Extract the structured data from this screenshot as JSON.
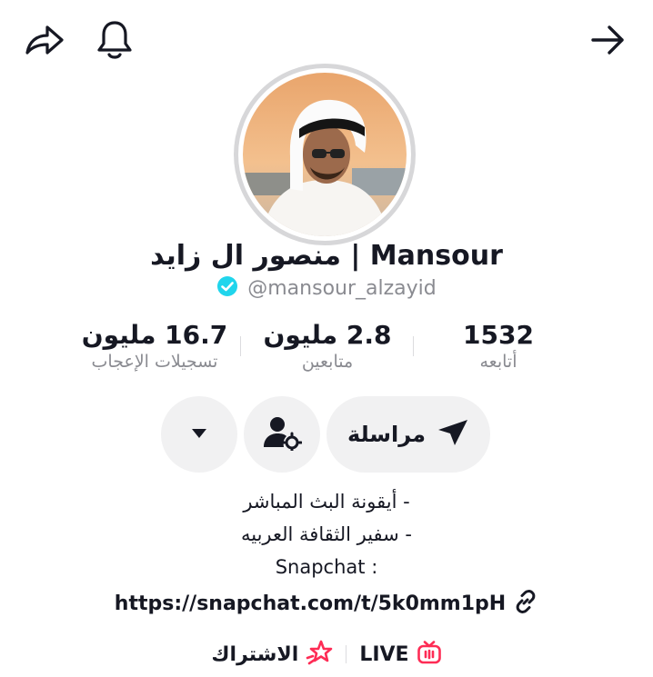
{
  "topbar": {
    "share_icon": "share-arrow-icon",
    "bell_icon": "bell-icon",
    "back_icon": "arrow-right-icon"
  },
  "profile": {
    "display_name": "منصور ال زايد | Mansour",
    "handle": "@mansour_alzayid",
    "verified": true,
    "verified_color": "#20d5ec"
  },
  "stats": [
    {
      "value": "1532",
      "label": "أتابعه"
    },
    {
      "value": "2.8 مليون",
      "label": "متابعين"
    },
    {
      "value": "16.7 مليون",
      "label": "تسجيلات الإعجاب"
    }
  ],
  "actions": {
    "message_label": "مراسلة",
    "message_icon": "send-icon",
    "friends_icon": "user-settings-icon",
    "more_icon": "caret-down-icon"
  },
  "bio": {
    "line1": "- أيقونة البث المباشر",
    "line2": "- سفير الثقافة العربيه",
    "line3": "Snapchat :",
    "link": "https://snapchat.com/t/5k0mm1pH"
  },
  "bottom": {
    "live_label": "LIVE",
    "subscribe_label": "الاشتراك",
    "accent": "#fe2c55"
  }
}
